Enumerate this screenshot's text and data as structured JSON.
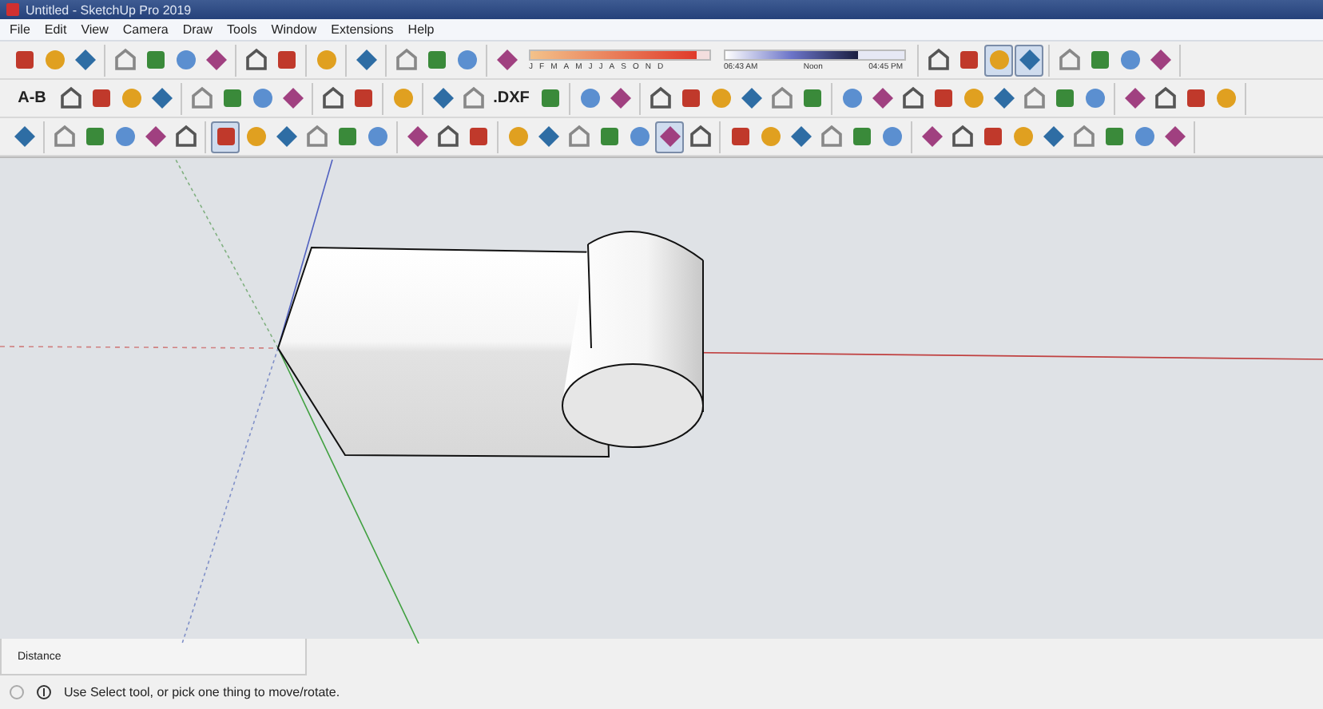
{
  "window": {
    "title": "Untitled - SketchUp Pro 2019"
  },
  "menu": [
    "File",
    "Edit",
    "View",
    "Camera",
    "Draw",
    "Tools",
    "Window",
    "Extensions",
    "Help"
  ],
  "toolbars": [
    {
      "groups": [
        [
          {
            "kind": "icon",
            "selected": false
          },
          {
            "kind": "icon",
            "selected": false
          },
          {
            "kind": "icon",
            "selected": false
          }
        ],
        [
          {
            "kind": "icon",
            "selected": false
          },
          {
            "kind": "icon",
            "selected": false
          },
          {
            "kind": "icon",
            "selected": false
          },
          {
            "kind": "icon",
            "selected": false
          }
        ],
        [
          {
            "kind": "icon",
            "selected": false
          },
          {
            "kind": "icon",
            "selected": false
          }
        ],
        [
          {
            "kind": "icon",
            "selected": false
          }
        ],
        [
          {
            "kind": "icon",
            "selected": false
          }
        ],
        [
          {
            "kind": "icon",
            "selected": false
          },
          {
            "kind": "icon",
            "selected": false
          },
          {
            "kind": "icon",
            "selected": false
          }
        ],
        [
          {
            "kind": "icon",
            "selected": false
          },
          {
            "kind": "shadows"
          }
        ],
        [
          {
            "kind": "icon",
            "selected": false
          },
          {
            "kind": "icon",
            "selected": false
          },
          {
            "kind": "icon",
            "selected": true
          },
          {
            "kind": "icon",
            "selected": true
          }
        ],
        [
          {
            "kind": "icon",
            "selected": false
          },
          {
            "kind": "icon",
            "selected": false
          },
          {
            "kind": "icon",
            "selected": false
          },
          {
            "kind": "icon",
            "selected": false
          }
        ]
      ]
    },
    {
      "groups": [
        [
          {
            "kind": "text",
            "label": "A-B"
          },
          {
            "kind": "icon",
            "selected": false
          },
          {
            "kind": "icon",
            "selected": false
          },
          {
            "kind": "icon",
            "selected": false
          },
          {
            "kind": "icon",
            "selected": false
          }
        ],
        [
          {
            "kind": "icon",
            "selected": false
          },
          {
            "kind": "icon",
            "selected": false
          },
          {
            "kind": "icon",
            "selected": false
          },
          {
            "kind": "icon",
            "selected": false
          }
        ],
        [
          {
            "kind": "icon",
            "selected": false
          },
          {
            "kind": "icon",
            "selected": false
          }
        ],
        [
          {
            "kind": "icon",
            "selected": false
          }
        ],
        [
          {
            "kind": "icon",
            "selected": false
          },
          {
            "kind": "icon",
            "selected": false
          },
          {
            "kind": "text",
            "label": ".DXF"
          },
          {
            "kind": "icon",
            "selected": false
          }
        ],
        [
          {
            "kind": "icon",
            "selected": false
          },
          {
            "kind": "icon",
            "selected": false
          }
        ],
        [
          {
            "kind": "icon",
            "selected": false
          },
          {
            "kind": "icon",
            "selected": false
          },
          {
            "kind": "icon",
            "selected": false
          },
          {
            "kind": "icon",
            "selected": false
          },
          {
            "kind": "icon",
            "selected": false
          },
          {
            "kind": "icon",
            "selected": false
          }
        ],
        [
          {
            "kind": "icon",
            "selected": false
          },
          {
            "kind": "icon",
            "selected": false
          },
          {
            "kind": "icon",
            "selected": false
          },
          {
            "kind": "icon",
            "selected": false
          },
          {
            "kind": "icon",
            "selected": false
          },
          {
            "kind": "icon",
            "selected": false
          },
          {
            "kind": "icon",
            "selected": false
          },
          {
            "kind": "icon",
            "selected": false
          },
          {
            "kind": "icon",
            "selected": false
          }
        ],
        [
          {
            "kind": "icon",
            "selected": false
          },
          {
            "kind": "icon",
            "selected": false
          },
          {
            "kind": "icon",
            "selected": false
          },
          {
            "kind": "icon",
            "selected": false
          }
        ]
      ]
    },
    {
      "groups": [
        [
          {
            "kind": "icon",
            "selected": false
          }
        ],
        [
          {
            "kind": "icon",
            "selected": false
          },
          {
            "kind": "icon",
            "selected": false
          },
          {
            "kind": "icon",
            "selected": false
          },
          {
            "kind": "icon",
            "selected": false
          },
          {
            "kind": "icon",
            "selected": false
          }
        ],
        [
          {
            "kind": "icon",
            "selected": true
          },
          {
            "kind": "icon",
            "selected": false
          },
          {
            "kind": "icon",
            "selected": false
          },
          {
            "kind": "icon",
            "selected": false
          },
          {
            "kind": "icon",
            "selected": false
          },
          {
            "kind": "icon",
            "selected": false
          }
        ],
        [
          {
            "kind": "icon",
            "selected": false
          },
          {
            "kind": "icon",
            "selected": false
          },
          {
            "kind": "icon",
            "selected": false
          }
        ],
        [
          {
            "kind": "icon",
            "selected": false
          },
          {
            "kind": "icon",
            "selected": false
          },
          {
            "kind": "icon",
            "selected": false
          },
          {
            "kind": "icon",
            "selected": false
          },
          {
            "kind": "icon",
            "selected": false
          },
          {
            "kind": "icon",
            "selected": true
          },
          {
            "kind": "icon",
            "selected": false
          }
        ],
        [
          {
            "kind": "icon",
            "selected": false
          },
          {
            "kind": "icon",
            "selected": false
          },
          {
            "kind": "icon",
            "selected": false
          },
          {
            "kind": "icon",
            "selected": false
          },
          {
            "kind": "icon",
            "selected": false
          },
          {
            "kind": "icon",
            "selected": false
          }
        ],
        [
          {
            "kind": "icon",
            "selected": false
          },
          {
            "kind": "icon",
            "selected": false
          },
          {
            "kind": "icon",
            "selected": false
          },
          {
            "kind": "icon",
            "selected": false
          },
          {
            "kind": "icon",
            "selected": false
          },
          {
            "kind": "icon",
            "selected": false
          },
          {
            "kind": "icon",
            "selected": false
          },
          {
            "kind": "icon",
            "selected": false
          },
          {
            "kind": "icon",
            "selected": false
          }
        ]
      ]
    }
  ],
  "shadows": {
    "months": [
      "J",
      "F",
      "M",
      "A",
      "M",
      "J",
      "J",
      "A",
      "S",
      "O",
      "N",
      "D"
    ],
    "month_slider": {
      "level": 0.93
    },
    "time_slider": {
      "level": 0.74
    },
    "times": [
      "06:43 AM",
      "Noon",
      "04:45 PM"
    ]
  },
  "measurements": {
    "label": "Distance"
  },
  "status_bar": {
    "message": "Use Select tool, or pick one thing to move/rotate."
  }
}
